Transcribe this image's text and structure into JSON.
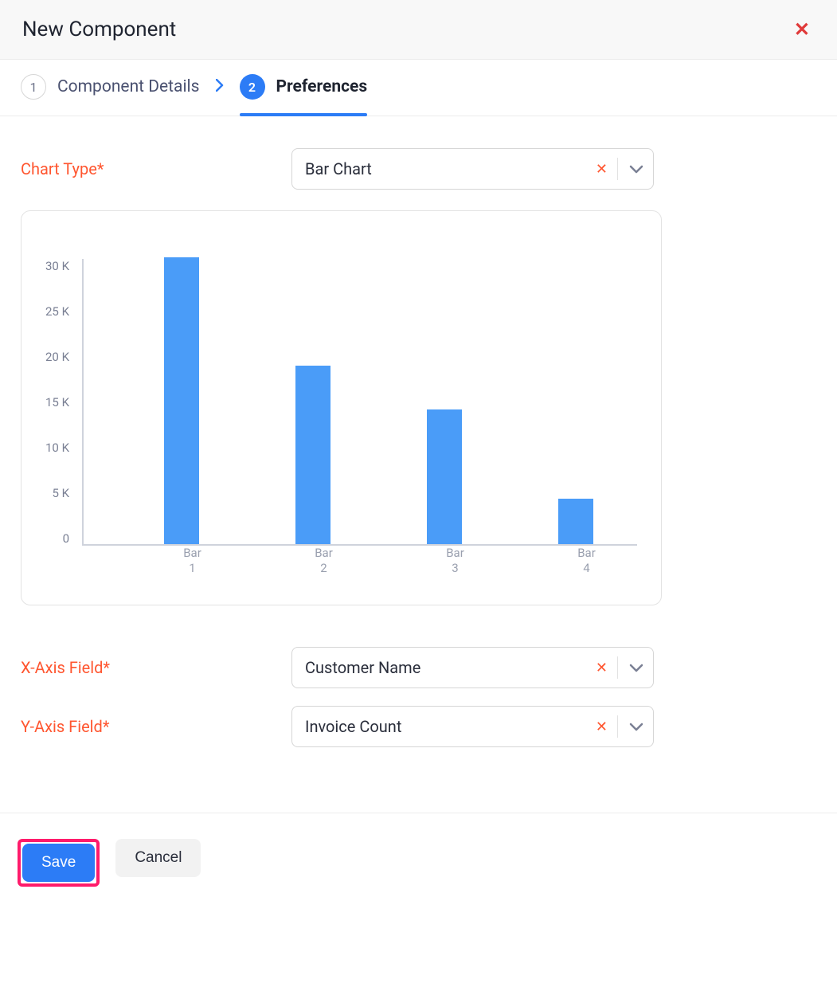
{
  "header": {
    "title": "New Component"
  },
  "steps": {
    "s1": {
      "num": "1",
      "label": "Component Details"
    },
    "s2": {
      "num": "2",
      "label": "Preferences"
    }
  },
  "fields": {
    "chart_type": {
      "label": "Chart Type*",
      "value": "Bar Chart"
    },
    "x_axis": {
      "label": "X-Axis Field*",
      "value": "Customer Name"
    },
    "y_axis": {
      "label": "Y-Axis Field*",
      "value": "Invoice Count"
    }
  },
  "footer": {
    "save": "Save",
    "cancel": "Cancel"
  },
  "chart_data": {
    "type": "bar",
    "categories": [
      "Bar 1",
      "Bar 2",
      "Bar 3",
      "Bar 4"
    ],
    "values": [
      33000,
      20500,
      15500,
      5200
    ],
    "y_ticks": [
      "30 K",
      "25 K",
      "20 K",
      "15 K",
      "10 K",
      "5 K",
      "0"
    ],
    "ylim": [
      0,
      33000
    ],
    "title": "",
    "xlabel": "",
    "ylabel": ""
  }
}
